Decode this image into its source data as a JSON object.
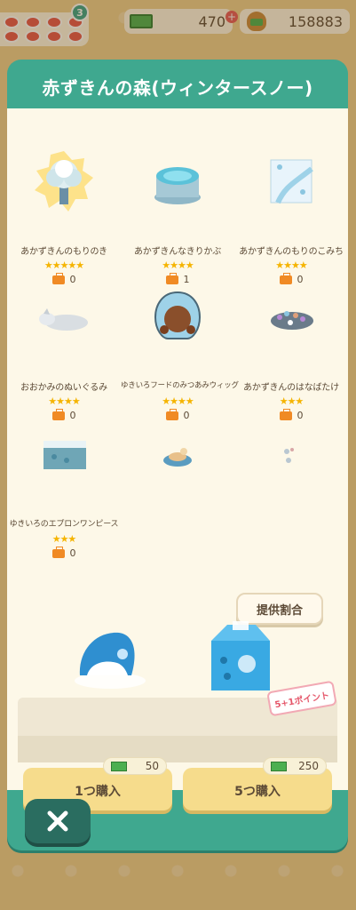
{
  "topbar": {
    "notification_count": "3",
    "cash_amount": "470",
    "coin_amount": "158883"
  },
  "modal": {
    "title": "赤ずきんの森(ウィンタースノー)",
    "items": [
      {
        "name": "あかずきんのもりのき",
        "stars": "★★★★★",
        "owned": "0"
      },
      {
        "name": "あかずきんなきりかぶ",
        "stars": "★★★★",
        "owned": "1"
      },
      {
        "name": "あかずきんのもりのこみち",
        "stars": "★★★★",
        "owned": "0"
      },
      {
        "name": "おおかみのぬいぐるみ",
        "stars": "★★★★",
        "owned": "0"
      },
      {
        "name": "ゆきいろフードのみつあみウィッグ",
        "stars": "★★★★",
        "owned": "0"
      },
      {
        "name": "あかずきんのはなばたけ",
        "stars": "★★★",
        "owned": "0"
      },
      {
        "name": "ゆきいろのエプロンワンピース",
        "stars": "★★★",
        "owned": "0"
      }
    ],
    "rate_button": "提供割合",
    "promo_tag": "5+1ポイント",
    "buy_one": {
      "label": "1つ購入",
      "price": "50"
    },
    "buy_five": {
      "label": "5つ購入",
      "price": "250"
    }
  }
}
